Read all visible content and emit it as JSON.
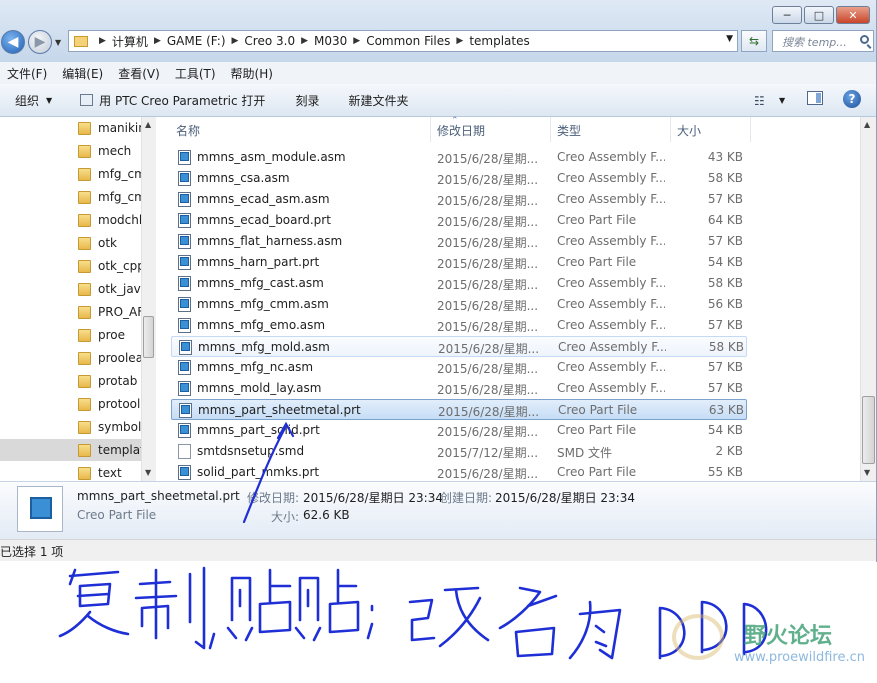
{
  "window": {
    "caption_buttons": [
      "minimize",
      "maximize",
      "close"
    ],
    "caption_glyphs": [
      "─",
      "□",
      "✕"
    ]
  },
  "address_bar": {
    "path": [
      "计算机",
      "GAME (F:)",
      "Creo 3.0",
      "M030",
      "Common Files",
      "templates"
    ],
    "search_placeholder": "搜索 temp..."
  },
  "menu": [
    "文件(F)",
    "编辑(E)",
    "查看(V)",
    "工具(T)",
    "帮助(H)"
  ],
  "toolbar": {
    "organize": "组织",
    "open_with": "用 PTC Creo Parametric 打开",
    "burn": "刻录",
    "new_folder": "新建文件夹"
  },
  "nav_items": [
    {
      "label": "manikin"
    },
    {
      "label": "mech"
    },
    {
      "label": "mfg_cmm"
    },
    {
      "label": "mfg_cmm"
    },
    {
      "label": "modchk"
    },
    {
      "label": "otk"
    },
    {
      "label": "otk_cpp"
    },
    {
      "label": "otk_java"
    },
    {
      "label": "PRO_AF"
    },
    {
      "label": "proe"
    },
    {
      "label": "prooleapp"
    },
    {
      "label": "protab"
    },
    {
      "label": "protoolkit"
    },
    {
      "label": "symbols"
    },
    {
      "label": "templates",
      "selected": true
    },
    {
      "label": "text"
    }
  ],
  "columns": {
    "name": "名称",
    "date": "修改日期",
    "type": "类型",
    "size": "大小"
  },
  "files": [
    {
      "name": "mmns_asm_module.asm",
      "date": "2015/6/28/星期...",
      "type": "Creo Assembly F...",
      "size": "43 KB"
    },
    {
      "name": "mmns_csa.asm",
      "date": "2015/6/28/星期...",
      "type": "Creo Assembly F...",
      "size": "58 KB"
    },
    {
      "name": "mmns_ecad_asm.asm",
      "date": "2015/6/28/星期...",
      "type": "Creo Assembly F...",
      "size": "57 KB"
    },
    {
      "name": "mmns_ecad_board.prt",
      "date": "2015/6/28/星期...",
      "type": "Creo Part File",
      "size": "64 KB"
    },
    {
      "name": "mmns_flat_harness.asm",
      "date": "2015/6/28/星期...",
      "type": "Creo Assembly F...",
      "size": "57 KB"
    },
    {
      "name": "mmns_harn_part.prt",
      "date": "2015/6/28/星期...",
      "type": "Creo Part File",
      "size": "54 KB"
    },
    {
      "name": "mmns_mfg_cast.asm",
      "date": "2015/6/28/星期...",
      "type": "Creo Assembly F...",
      "size": "58 KB"
    },
    {
      "name": "mmns_mfg_cmm.asm",
      "date": "2015/6/28/星期...",
      "type": "Creo Assembly F...",
      "size": "56 KB"
    },
    {
      "name": "mmns_mfg_emo.asm",
      "date": "2015/6/28/星期...",
      "type": "Creo Assembly F...",
      "size": "57 KB"
    },
    {
      "name": "mmns_mfg_mold.asm",
      "date": "2015/6/28/星期...",
      "type": "Creo Assembly F...",
      "size": "58 KB",
      "state": "hover"
    },
    {
      "name": "mmns_mfg_nc.asm",
      "date": "2015/6/28/星期...",
      "type": "Creo Assembly F...",
      "size": "57 KB"
    },
    {
      "name": "mmns_mold_lay.asm",
      "date": "2015/6/28/星期...",
      "type": "Creo Assembly F...",
      "size": "57 KB"
    },
    {
      "name": "mmns_part_sheetmetal.prt",
      "date": "2015/6/28/星期...",
      "type": "Creo Part File",
      "size": "63 KB",
      "state": "selected"
    },
    {
      "name": "mmns_part_solid.prt",
      "date": "2015/6/28/星期...",
      "type": "Creo Part File",
      "size": "54 KB"
    },
    {
      "name": "smtdsnsetup.smd",
      "date": "2015/7/12/星期...",
      "type": "SMD 文件",
      "size": "2 KB",
      "icon": "plain"
    },
    {
      "name": "solid_part_mmks.prt",
      "date": "2015/6/28/星期...",
      "type": "Creo Part File",
      "size": "55 KB"
    }
  ],
  "details": {
    "filename": "mmns_part_sheetmetal.prt",
    "filetype": "Creo Part File",
    "modified_label": "修改日期:",
    "modified": "2015/6/28/星期日 23:34",
    "created_label": "创建日期:",
    "created": "2015/6/28/星期日 23:34",
    "size_label": "大小:",
    "size": "62.6 KB"
  },
  "status": "已选择 1 项",
  "annotation": {
    "handwritten_note": "复制,贴贴;改名为DD",
    "watermark_text": "野火论坛",
    "watermark_url": "www.proewildfire.cn"
  },
  "colors": {
    "selection": "#c6ddf6",
    "handwriting": "#1f2fd6",
    "watermark": "#46a37a"
  }
}
